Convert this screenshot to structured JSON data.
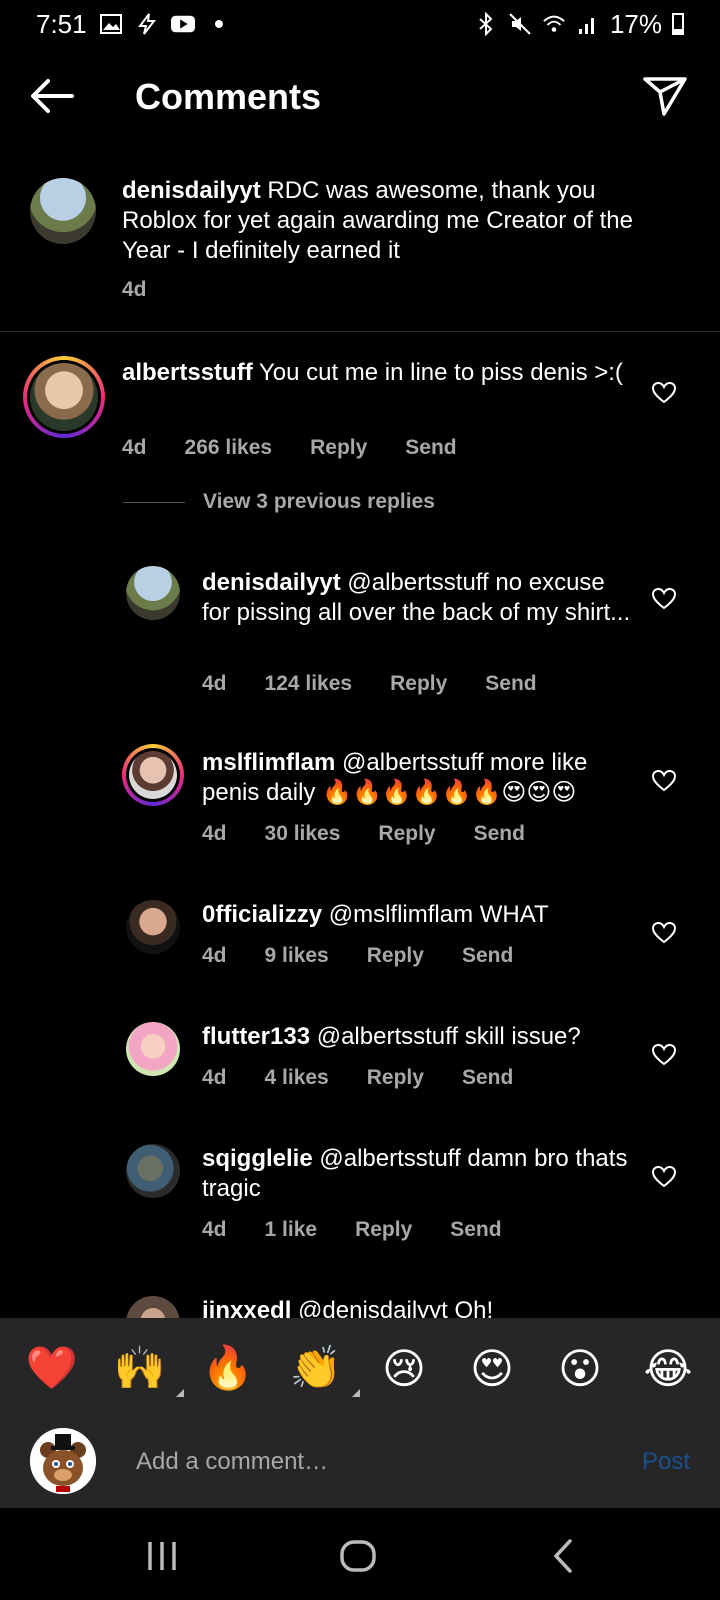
{
  "status_bar": {
    "time": "7:51",
    "battery": "17%"
  },
  "header": {
    "title": "Comments"
  },
  "caption": {
    "username": "denisdailyyt",
    "text": "RDC was awesome, thank you Roblox for yet again awarding me Creator of the Year - I definitely earned it",
    "time": "4d"
  },
  "comments": [
    {
      "username": "albertsstuff",
      "text": "You cut me in line to piss denis >:(",
      "time": "4d",
      "likes": "266 likes",
      "reply": "Reply",
      "send": "Send"
    }
  ],
  "view_replies": "View 3 previous replies",
  "replies": [
    {
      "username": "denisdailyyt",
      "text": "@albertsstuff no excuse for pissing all over the back of my shirt...",
      "time": "4d",
      "likes": "124 likes",
      "reply": "Reply",
      "send": "Send"
    },
    {
      "username": "mslflimflam",
      "text": "@albertsstuff more like penis daily 🔥🔥🔥🔥🔥🔥😍😍😍",
      "time": "4d",
      "likes": "30 likes",
      "reply": "Reply",
      "send": "Send"
    },
    {
      "username": "0fficializzy",
      "text": "@mslflimflam WHAT",
      "time": "4d",
      "likes": "9 likes",
      "reply": "Reply",
      "send": "Send"
    },
    {
      "username": "flutter133",
      "text": "@albertsstuff skill issue?",
      "time": "4d",
      "likes": "4 likes",
      "reply": "Reply",
      "send": "Send"
    },
    {
      "username": "sqigglelie",
      "text": "@albertsstuff damn bro thats tragic",
      "time": "4d",
      "likes": "1 like",
      "reply": "Reply",
      "send": "Send"
    },
    {
      "username": "jinxxedl",
      "text": "@denisdailyyt Oh!"
    }
  ],
  "emoji_bar": [
    "❤️",
    "🙌",
    "🔥",
    "👏",
    "😢",
    "😍",
    "😮",
    "😂"
  ],
  "input": {
    "placeholder": "Add a comment…",
    "post": "Post"
  },
  "colors": {
    "background": "#000000",
    "secondary_text": "#a8a8a8",
    "post_disabled": "#1c4f8f",
    "bar": "#262626"
  }
}
